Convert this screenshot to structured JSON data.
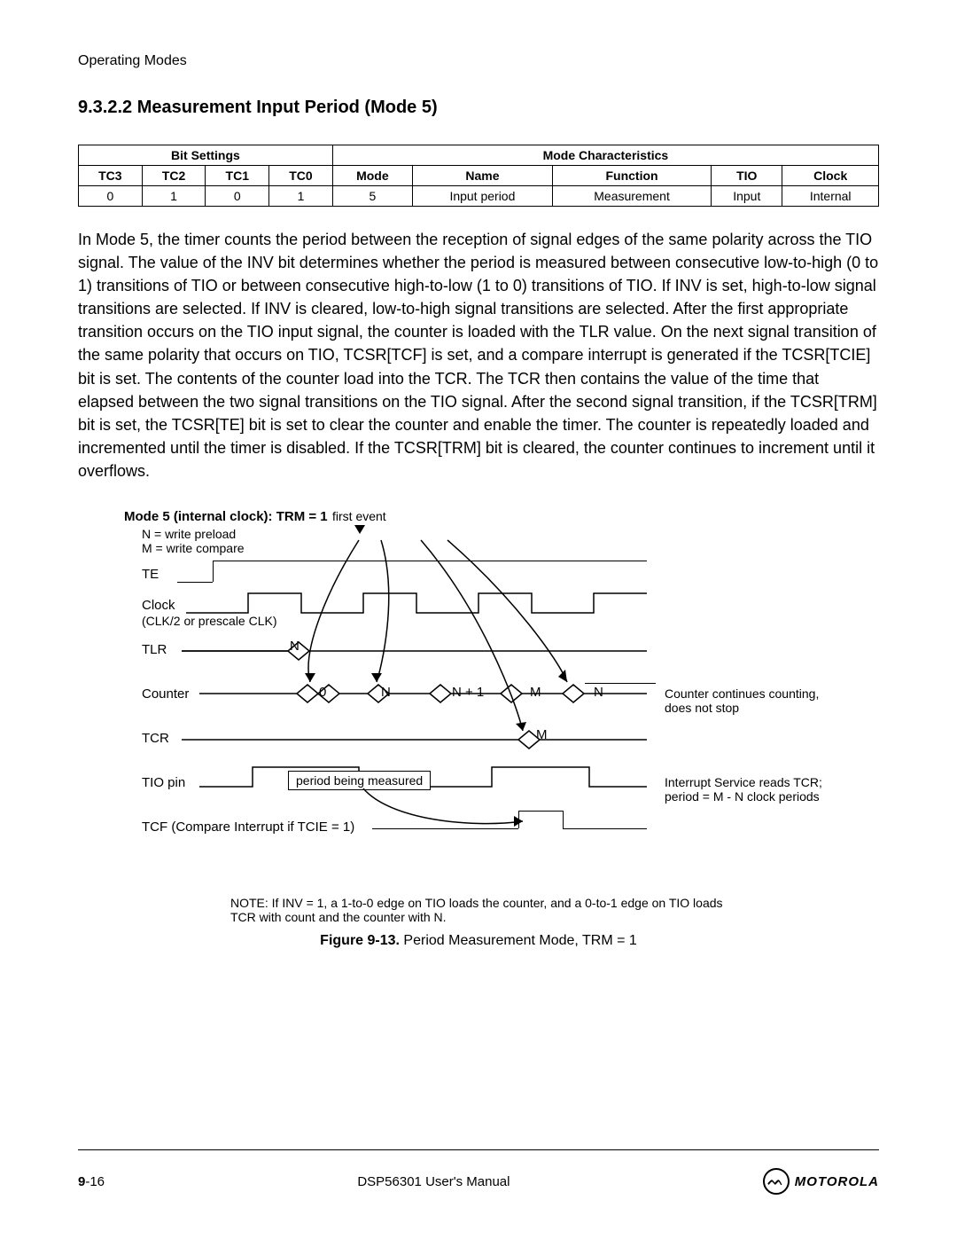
{
  "header": "Operating Modes",
  "section_heading": "9.3.2.2 Measurement Input Period (Mode 5)",
  "table": {
    "group_headers": [
      "Bit Settings",
      "Mode Characteristics"
    ],
    "columns": [
      "TC3",
      "TC2",
      "TC1",
      "TC0",
      "Mode",
      "Name",
      "Function",
      "TIO",
      "Clock"
    ],
    "row": [
      "0",
      "1",
      "0",
      "1",
      "5",
      "Input period",
      "Measurement",
      "Input",
      "Internal"
    ]
  },
  "body": "In Mode 5, the timer counts the period between the reception of signal edges of the same polarity across the TIO signal. The value of the INV bit determines whether the period is measured between consecutive low-to-high (0 to 1) transitions of TIO or between consecutive high-to-low (1 to 0) transitions of TIO. If INV is set, high-to-low signal transitions are selected. If INV is cleared, low-to-high signal transitions are selected. After the first appropriate transition occurs on the TIO input signal, the counter is loaded with the TLR value. On the next signal transition of the same polarity that occurs on TIO, TCSR[TCF] is set, and a compare interrupt is generated if the TCSR[TCIE] bit is set. The contents of the counter load into the TCR. The TCR then contains the value of the time that elapsed between the two signal transitions on the TIO signal. After the second signal transition, if the TCSR[TRM] bit is set, the TCSR[TE] bit is set to clear the counter and enable the timer. The counter is repeatedly loaded and incremented until the timer is disabled. If the TCSR[TRM] bit is cleared, the counter continues to increment until it overflows.",
  "figure": {
    "title": "Mode 5 (internal clock): TRM = 1",
    "first_event": "first event",
    "legend1": "N = write preload",
    "legend2": "M = write compare",
    "labels": {
      "te": "TE",
      "clock": "Clock",
      "clock_sub": "(CLK/2 or prescale CLK)",
      "tlr": "TLR",
      "counter": "Counter",
      "tcr": "TCR",
      "tio": "TIO pin",
      "tcf": "TCF (Compare Interrupt if TCIE = 1)"
    },
    "values": {
      "tlr_n": "N",
      "c0": "0",
      "c1": "N",
      "c2": "N + 1",
      "c3": "M",
      "c4": "N",
      "tcr_m": "M",
      "period_box": "period being measured"
    },
    "side_notes": {
      "note1": "Counter continues counting, does not stop",
      "note2": "Interrupt Service reads TCR; period = M - N clock periods"
    },
    "note": "NOTE: If INV = 1, a 1-to-0 edge on TIO loads the counter, and a 0-to-1 edge on TIO loads TCR with count and the counter with N.",
    "caption_bold": "Figure 9-13.",
    "caption_rest": " Period Measurement Mode, TRM = 1"
  },
  "footer": {
    "page_chapter": "9",
    "page_num": "-16",
    "manual": "DSP56301 User's Manual",
    "brand": "MOTOROLA"
  }
}
